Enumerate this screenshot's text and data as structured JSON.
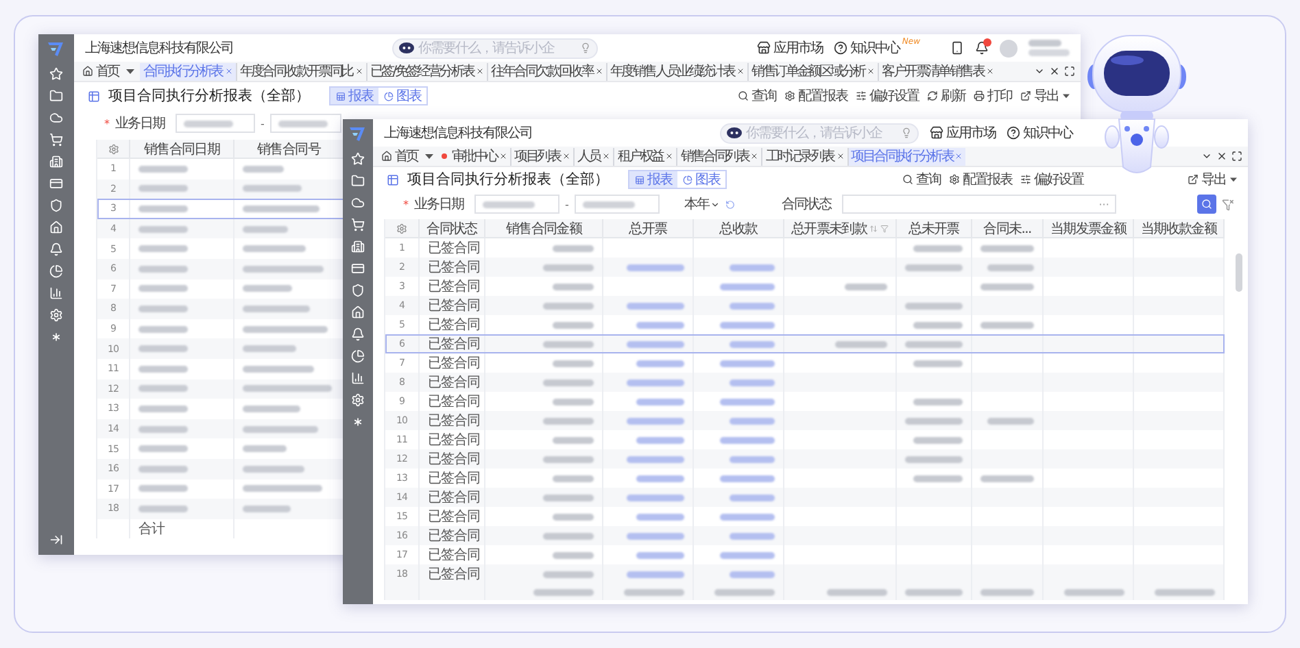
{
  "back_window": {
    "company": "上海速想信息科技有限公司",
    "search": {
      "placeholder": "你需要什么，请告诉小企"
    },
    "header_links": [
      {
        "label": "应用市场",
        "kind": "store"
      },
      {
        "label": "知识中心",
        "kind": "help",
        "badge": "New"
      }
    ],
    "tabs": [
      {
        "label": "首页",
        "kind": "home",
        "selected": false
      },
      {
        "label": "合同执行分析表",
        "kind": "page",
        "selected": true
      },
      {
        "label": "年度合同收款开票同比",
        "kind": "page",
        "selected": false
      },
      {
        "label": "已签/免签经营分析表",
        "kind": "page",
        "selected": false
      },
      {
        "label": "往年合同欠款回收率",
        "kind": "page",
        "selected": false
      },
      {
        "label": "年度销售人员业绩统计表",
        "kind": "page",
        "selected": false
      },
      {
        "label": "销售订单金额区域分析",
        "kind": "page",
        "selected": false
      },
      {
        "label": "客户开票清单销售表",
        "kind": "page",
        "selected": false
      }
    ],
    "report_title": "项目合同执行分析报表（全部）",
    "views": [
      {
        "label": "报表",
        "kind": "table",
        "selected": true
      },
      {
        "label": "图表",
        "kind": "chart",
        "selected": false
      }
    ],
    "actions": [
      {
        "label": "查询",
        "kind": "search"
      },
      {
        "label": "配置报表",
        "kind": "config"
      },
      {
        "label": "偏好设置",
        "kind": "prefs"
      },
      {
        "label": "刷新",
        "kind": "refresh"
      },
      {
        "label": "打印",
        "kind": "print"
      },
      {
        "label": "导出",
        "kind": "export"
      }
    ],
    "filter": {
      "required_mark": "*",
      "label": "业务日期",
      "separator": "-"
    },
    "table": {
      "columns": [
        "销售合同日期",
        "销售合同号"
      ],
      "total_label": "合计",
      "rows": [
        {
          "index": "1",
          "selected": false
        },
        {
          "index": "2",
          "selected": false
        },
        {
          "index": "3",
          "selected": true
        },
        {
          "index": "4",
          "selected": false
        },
        {
          "index": "5",
          "selected": false
        },
        {
          "index": "6",
          "selected": false
        },
        {
          "index": "7",
          "selected": false
        },
        {
          "index": "8",
          "selected": false
        },
        {
          "index": "9",
          "selected": false
        },
        {
          "index": "10",
          "selected": false
        },
        {
          "index": "11",
          "selected": false
        },
        {
          "index": "12",
          "selected": false
        },
        {
          "index": "13",
          "selected": false
        },
        {
          "index": "14",
          "selected": false
        },
        {
          "index": "15",
          "selected": false
        },
        {
          "index": "16",
          "selected": false
        },
        {
          "index": "17",
          "selected": false
        },
        {
          "index": "18",
          "selected": false
        }
      ]
    }
  },
  "front_window": {
    "company": "上海速想信息科技有限公司",
    "search": {
      "placeholder": "你需要什么，请告诉小企"
    },
    "header_links": [
      {
        "label": "应用市场",
        "kind": "store"
      },
      {
        "label": "知识中心",
        "kind": "help"
      }
    ],
    "tabs": [
      {
        "label": "首页",
        "kind": "home",
        "selected": false
      },
      {
        "label": "审批中心",
        "kind": "alert",
        "selected": false
      },
      {
        "label": "项目列表",
        "kind": "page",
        "selected": false
      },
      {
        "label": "人员",
        "kind": "page",
        "selected": false
      },
      {
        "label": "租户权益",
        "kind": "page",
        "selected": false
      },
      {
        "label": "销售合同列表",
        "kind": "page",
        "selected": false
      },
      {
        "label": "工时记录列表",
        "kind": "page",
        "selected": false
      },
      {
        "label": "项目合同执行分析表",
        "kind": "page",
        "selected": true
      }
    ],
    "report_title": "项目合同执行分析报表（全部）",
    "views": [
      {
        "label": "报表",
        "kind": "table",
        "selected": true
      },
      {
        "label": "图表",
        "kind": "chart",
        "selected": false
      }
    ],
    "actions_left": [
      {
        "label": "查询",
        "kind": "search"
      },
      {
        "label": "配置报表",
        "kind": "config"
      },
      {
        "label": "偏好设置",
        "kind": "prefs"
      }
    ],
    "actions_right": [
      {
        "label": "导出",
        "kind": "export"
      }
    ],
    "filter": {
      "required_mark": "*",
      "label": "业务日期",
      "separator": "-",
      "period": "本年",
      "status_label": "合同状态",
      "more": "···"
    },
    "table": {
      "columns": [
        {
          "label": "合同状态",
          "kind": "plain"
        },
        {
          "label": "销售合同金额",
          "kind": "plain"
        },
        {
          "label": "总开票",
          "kind": "plain"
        },
        {
          "label": "总收款",
          "kind": "plain"
        },
        {
          "label": "总开票未到款",
          "kind": "sortable"
        },
        {
          "label": "总未开票",
          "kind": "plain"
        },
        {
          "label": "合同未...",
          "kind": "plain"
        },
        {
          "label": "当期发票金额",
          "kind": "plain"
        },
        {
          "label": "当期收款金额",
          "kind": "plain"
        }
      ],
      "rows": [
        {
          "index": "1",
          "status": "已签合同",
          "selected": false
        },
        {
          "index": "2",
          "status": "已签合同",
          "selected": false
        },
        {
          "index": "3",
          "status": "已签合同",
          "selected": false
        },
        {
          "index": "4",
          "status": "已签合同",
          "selected": false
        },
        {
          "index": "5",
          "status": "已签合同",
          "selected": false
        },
        {
          "index": "6",
          "status": "已签合同",
          "selected": true
        },
        {
          "index": "7",
          "status": "已签合同",
          "selected": false
        },
        {
          "index": "8",
          "status": "已签合同",
          "selected": false
        },
        {
          "index": "9",
          "status": "已签合同",
          "selected": false
        },
        {
          "index": "10",
          "status": "已签合同",
          "selected": false
        },
        {
          "index": "11",
          "status": "已签合同",
          "selected": false
        },
        {
          "index": "12",
          "status": "已签合同",
          "selected": false
        },
        {
          "index": "13",
          "status": "已签合同",
          "selected": false
        },
        {
          "index": "14",
          "status": "已签合同",
          "selected": false
        },
        {
          "index": "15",
          "status": "已签合同",
          "selected": false
        },
        {
          "index": "16",
          "status": "已签合同",
          "selected": false
        },
        {
          "index": "17",
          "status": "已签合同",
          "selected": false
        },
        {
          "index": "18",
          "status": "已签合同",
          "selected": false
        }
      ]
    }
  }
}
